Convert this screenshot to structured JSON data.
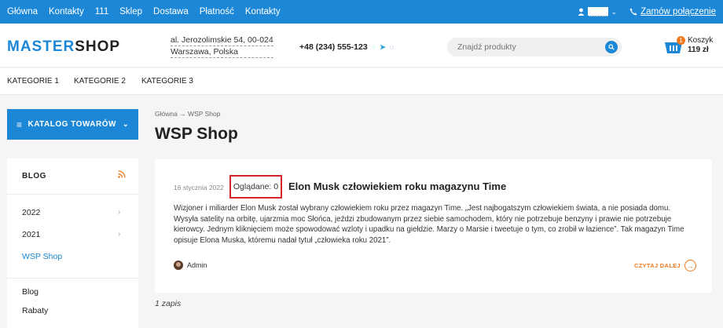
{
  "topbar": {
    "nav": [
      "Główna",
      "Kontakty",
      "111",
      "Sklep",
      "Dostawa",
      "Płatność",
      "Kontakty"
    ],
    "order_call": "Zamów połączenie"
  },
  "header": {
    "logo_accent": "MASTER",
    "logo_rest": "SHOP",
    "address_line1": "al. Jerozolimskie 54, 00-024",
    "address_line2": "Warszawa, Polska",
    "phone": "+48 (234) 555-123",
    "search_placeholder": "Znajdź produkty",
    "cart_label": "Koszyk",
    "cart_total": "119 zł",
    "cart_count": "1"
  },
  "categories": [
    "KATEGORIE 1",
    "KATEGORIE 2",
    "KATEGORIE 3"
  ],
  "sidebar": {
    "catalog_button": "KATALOG TOWARÓW",
    "blog_heading": "BLOG",
    "years": [
      "2022",
      "2021"
    ],
    "active_item": "WSP Shop",
    "links": [
      "Blog",
      "Rabaty"
    ]
  },
  "main": {
    "breadcrumb": "Główna → WSP Shop",
    "title": "WSP Shop",
    "post": {
      "date": "16 stycznia 2022",
      "views": "Oglądane: 0",
      "title": "Elon Musk człowiekiem roku magazynu Time",
      "body": "Wizjoner i miliarder Elon Musk został wybrany człowiekiem roku przez magazyn Time. „Jest najbogatszym człowiekiem świata, a nie posiada domu. Wysyła satelity na orbitę, ujarzmia moc Słońca, jeździ zbudowanym przez siebie samochodem, który nie potrzebuje benzyny i prawie nie potrzebuje kierowcy. Jednym kliknięciem może spowodować wzloty i upadku na giełdzie. Marzy o Marsie i tweetuje o tym, co zrobił w łazience”. Tak magazyn Time opisuje Elona Muska, któremu nadał tytuł „człowieka roku 2021”.",
      "author": "Admin",
      "read_more": "CZYTAJ DALEJ"
    },
    "count": "1 zapis"
  },
  "colors": {
    "primary": "#1b87d6",
    "accent": "#f07a1d",
    "highlight_border": "#d6222a"
  }
}
